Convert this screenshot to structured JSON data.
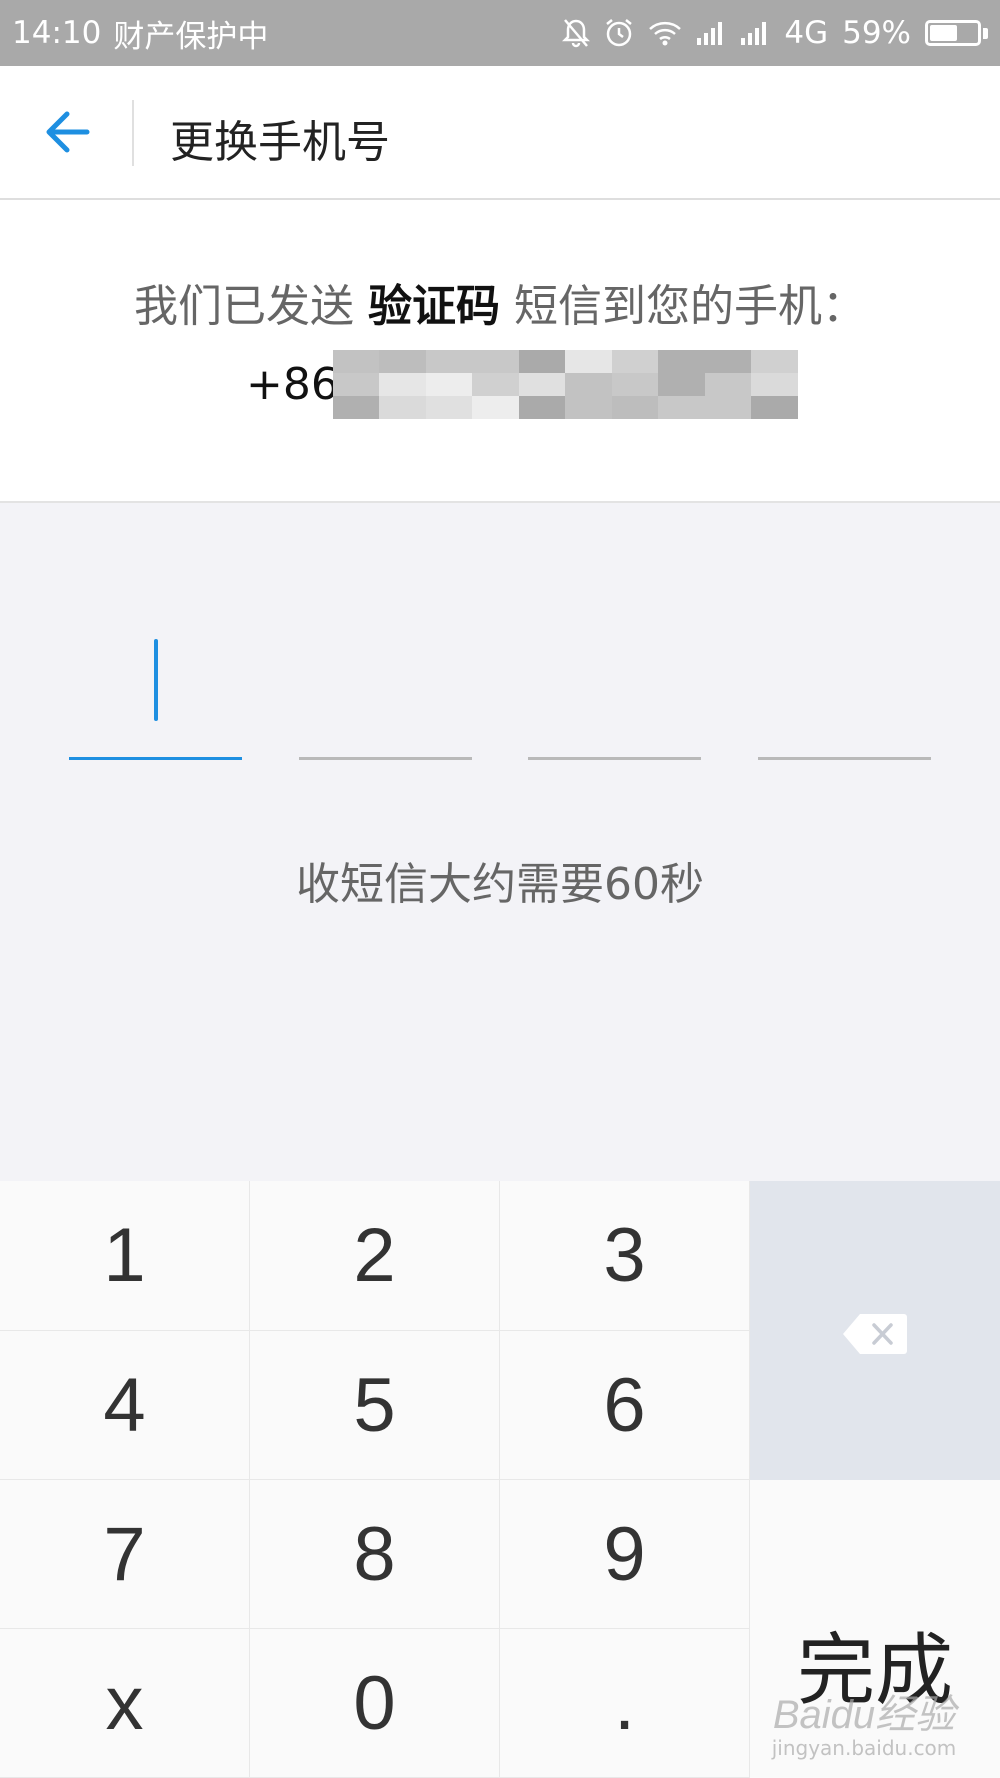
{
  "status_bar": {
    "time": "14:10",
    "notice": "财产保护中",
    "network": "4G",
    "battery_percent": "59%",
    "battery_level": 0.59,
    "icons": [
      "bell-off-icon",
      "alarm-icon",
      "wifi-icon",
      "signal-icon",
      "signal-icon"
    ]
  },
  "app_bar": {
    "back_icon": "arrow-left-icon",
    "title": "更换手机号"
  },
  "message": {
    "prefix": "我们已发送",
    "bold": "验证码",
    "suffix": "短信到您的手机：",
    "phone_prefix": "+86"
  },
  "code_input": {
    "digits": [
      "",
      "",
      "",
      ""
    ],
    "active_index": 0
  },
  "hint": "收短信大约需要60秒",
  "keypad": {
    "keys": [
      "1",
      "2",
      "3",
      "4",
      "5",
      "6",
      "7",
      "8",
      "9",
      "x",
      "0",
      "."
    ],
    "delete_icon": "backspace-icon",
    "done_label": "完成"
  },
  "watermark": {
    "logo": "Baidu经验",
    "sub": "jingyan.baidu.com"
  },
  "colors": {
    "accent": "#1e8fe1",
    "status_bar": "#a9a9a9",
    "input_area": "#f3f3f7",
    "delete_key": "#e1e5ec"
  }
}
